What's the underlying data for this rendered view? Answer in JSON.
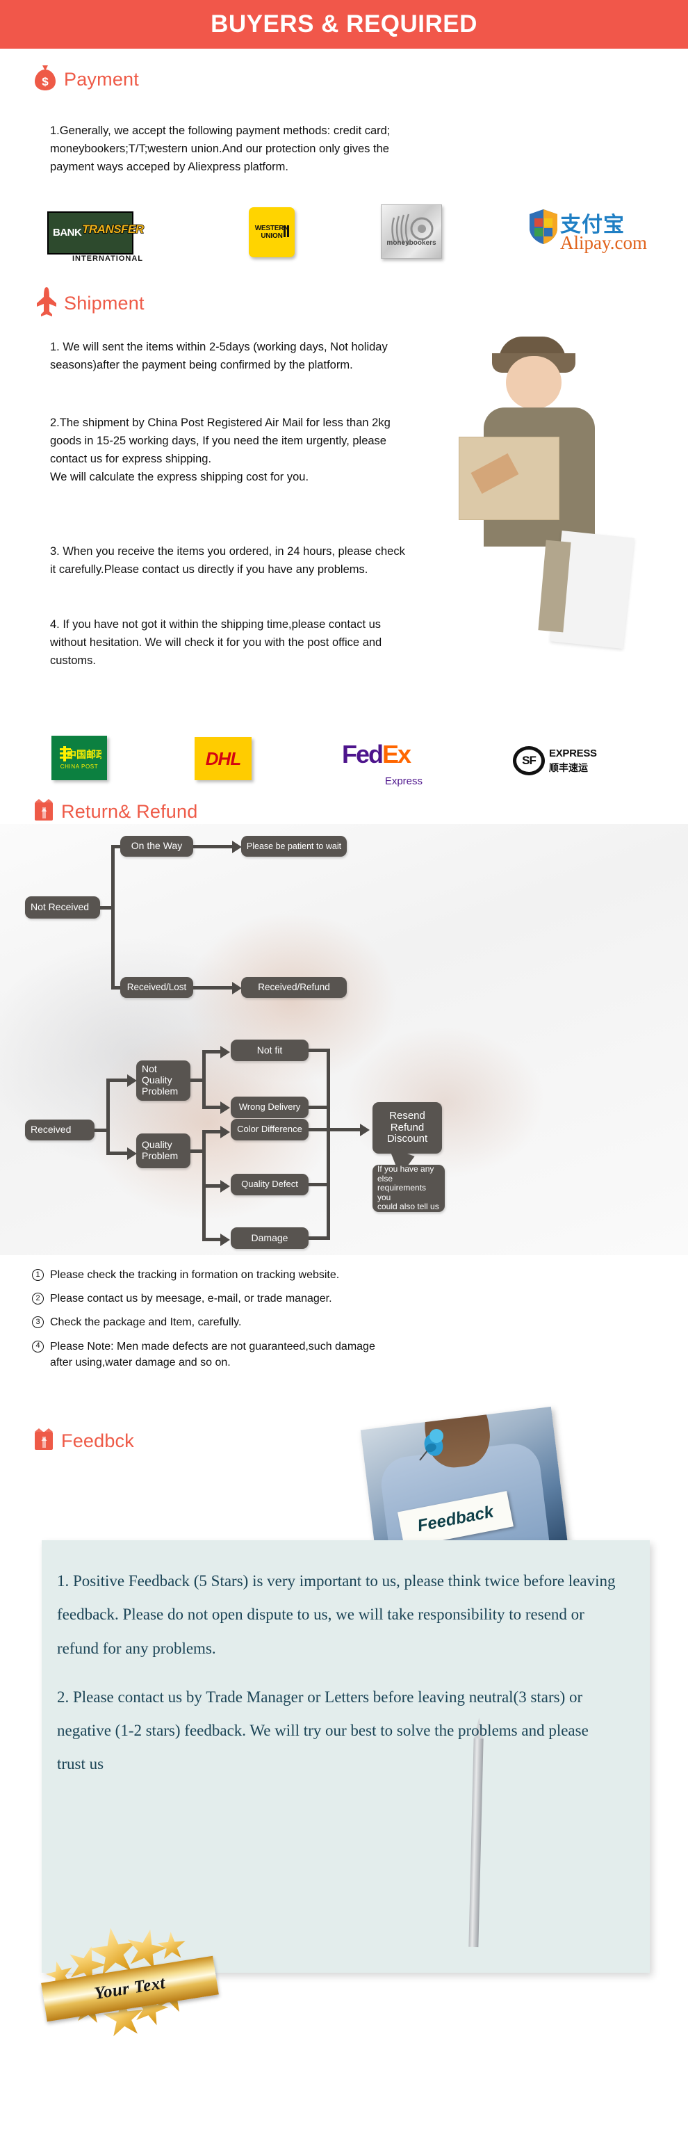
{
  "banner": {
    "title": "BUYERS & REQUIRED"
  },
  "sections": {
    "payment": {
      "heading": "Payment",
      "icon": "money-bag-icon",
      "body": "1.Generally, we accept the following payment methods: credit card;\nmoneybookers;T/T;western union.And our protection only gives the\npayment ways acceped by Aliexpress platform.",
      "logos": [
        {
          "name": "bank-transfer-logo",
          "line1": "BANK",
          "line2": "TRANSFER",
          "line3": "INTERNATIONAL"
        },
        {
          "name": "western-union-logo",
          "line1": "WESTERN",
          "line2": "UNION"
        },
        {
          "name": "moneybookers-logo",
          "line1": "moneybookers"
        },
        {
          "name": "alipay-logo",
          "line1": "支付宝",
          "line2": "Alipay.com"
        }
      ]
    },
    "shipment": {
      "heading": "Shipment",
      "icon": "airplane-icon",
      "body1": "1. We will sent the items within 2-5days (working days, Not holiday\nseasons)after the payment being confirmed by the platform.",
      "body2": "2.The shipment by China Post Registered Air Mail for less than  2kg\ngoods in 15-25 working days, If  you need the item urgently, please\ncontact us for express shipping.\nWe will calculate the express shipping cost for you.",
      "body3": "3. When you receive the items you ordered, in 24 hours, please check\n it carefully.Please contact us directly if you have any problems.",
      "body4": "4. If you have not got it within the shipping time,please contact us\nwithout hesitation. We will check it for you with the post office and\ncustoms.",
      "logos": [
        {
          "name": "china-post-logo",
          "line1": "中国邮政",
          "line2": "CHINA POST"
        },
        {
          "name": "dhl-logo",
          "line1": "DHL"
        },
        {
          "name": "fedex-logo",
          "line1": "Fed",
          "line2": "Ex",
          "line3": "Express"
        },
        {
          "name": "sf-express-logo",
          "line1": "SF",
          "line2": "EXPRESS",
          "line3": "顺丰速运"
        }
      ]
    },
    "return_refund": {
      "heading": "Return& Refund",
      "icon": "return-box-icon",
      "flow_nodes": [
        {
          "id": "not-received",
          "label": "Not Received"
        },
        {
          "id": "on-the-way",
          "label": "On the Way"
        },
        {
          "id": "please-be-patient",
          "label": "Please be patient to wait"
        },
        {
          "id": "received-lost",
          "label": "Received/Lost"
        },
        {
          "id": "received-refund",
          "label": "Received/Refund"
        },
        {
          "id": "received",
          "label": "Received"
        },
        {
          "id": "not-quality-problem",
          "label": "Not\nQuality\nProblem"
        },
        {
          "id": "quality-problem",
          "label": "Quality\nProblem"
        },
        {
          "id": "not-fit",
          "label": "Not fit"
        },
        {
          "id": "wrong-delivery",
          "label": "Wrong Delivery"
        },
        {
          "id": "color-difference",
          "label": "Color Difference"
        },
        {
          "id": "quality-defect",
          "label": "Quality Defect"
        },
        {
          "id": "damage",
          "label": "Damage"
        },
        {
          "id": "resend-refund-discount",
          "label": "Resend\nRefund\nDiscount"
        },
        {
          "id": "callout-note",
          "label": "If you have any else\nrequirements you\ncould also tell us"
        }
      ],
      "notes": [
        {
          "marker": "1",
          "text": "Please check the tracking in formation on tracking website."
        },
        {
          "marker": "2",
          "text": "Please contact us by meesage, e-mail, or trade manager."
        },
        {
          "marker": "3",
          "text": "Check the package and Item, carefully."
        },
        {
          "marker": "4",
          "text": "Please Note: Men made defects  are not guaranteed,such damage\n     after using,water damage and so on."
        }
      ]
    },
    "feedback": {
      "heading": "Feedbck",
      "icon": "return-box-icon",
      "photo_sign_text": "Feedback",
      "paragraph1": "1. Positive Feedback (5 Stars) is very important to us, please think twice before leaving feedback. Please do not open dispute to us,   we will take responsibility to resend or refund for any problems.",
      "paragraph2": "2. Please contact us by Trade Manager or Letters before leaving neutral(3 stars) or negative (1-2 stars) feedback. We will try our best to solve the problems and please trust us",
      "badge_text": "Your Text"
    }
  },
  "colors": {
    "banner_red": "#f1574a",
    "heading_red": "#ee5a47",
    "node_grey": "#585450",
    "feedback_panel": "#e3edec",
    "feedback_text": "#1b4456"
  }
}
